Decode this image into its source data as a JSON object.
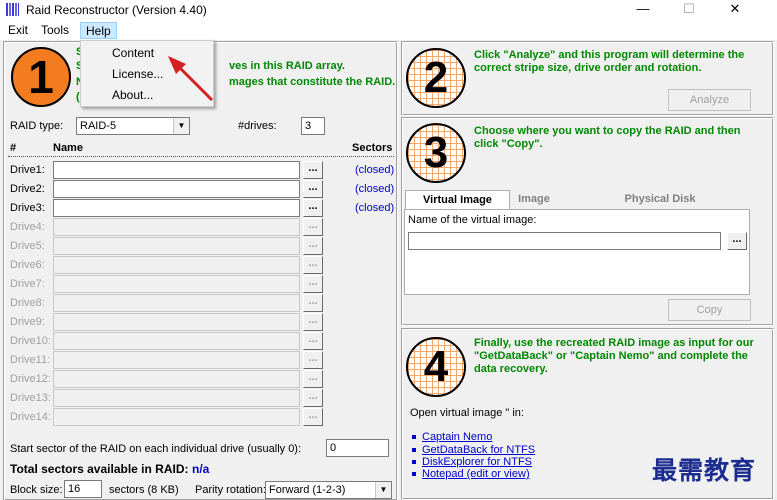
{
  "window": {
    "title": "Raid Reconstructor (Version 4.40)",
    "minimize": "—",
    "maximize": "☐",
    "close": "✕"
  },
  "menu": {
    "exit": "Exit",
    "tools": "Tools",
    "help": "Help",
    "help_items": [
      "Content",
      "License...",
      "About..."
    ]
  },
  "step1": {
    "number": "1",
    "line1": "Select the number of drives in this RAID array.",
    "line1_visible": "ves in this RAID array.",
    "line2_visible": "mages that constitute the RAID.",
    "left_fragments": [
      "S",
      "S",
      "N",
      "("
    ],
    "raid_type_label": "RAID type:",
    "raid_type_value": "RAID-5",
    "drives_label": "#drives:",
    "drives_value": "3",
    "col_hash": "#",
    "col_name": "Name",
    "col_sectors": "Sectors",
    "drives": [
      {
        "label": "Drive1:",
        "enabled": true,
        "status": "(closed)"
      },
      {
        "label": "Drive2:",
        "enabled": true,
        "status": "(closed)"
      },
      {
        "label": "Drive3:",
        "enabled": true,
        "status": "(closed)"
      },
      {
        "label": "Drive4:",
        "enabled": false,
        "status": ""
      },
      {
        "label": "Drive5:",
        "enabled": false,
        "status": ""
      },
      {
        "label": "Drive6:",
        "enabled": false,
        "status": ""
      },
      {
        "label": "Drive7:",
        "enabled": false,
        "status": ""
      },
      {
        "label": "Drive8:",
        "enabled": false,
        "status": ""
      },
      {
        "label": "Drive9:",
        "enabled": false,
        "status": ""
      },
      {
        "label": "Drive10:",
        "enabled": false,
        "status": ""
      },
      {
        "label": "Drive11:",
        "enabled": false,
        "status": ""
      },
      {
        "label": "Drive12:",
        "enabled": false,
        "status": ""
      },
      {
        "label": "Drive13:",
        "enabled": false,
        "status": ""
      },
      {
        "label": "Drive14:",
        "enabled": false,
        "status": ""
      }
    ],
    "browse_label": "...",
    "start_sector_label": "Start sector of the RAID on each individual drive (usually 0):",
    "start_sector_value": "0",
    "total_label": "Total sectors available in RAID:",
    "total_value": "n/a",
    "block_size_label": "Block size:",
    "block_size_value": "16",
    "block_size_unit": "sectors (8 KB)",
    "parity_label": "Parity rotation:",
    "parity_value": "Forward (1-2-3)"
  },
  "step2": {
    "number": "2",
    "text": "Click \"Analyze\" and this program will determine the correct stripe size, drive order and rotation.",
    "analyze": "Analyze"
  },
  "step3": {
    "number": "3",
    "text": "Choose where you want to copy the RAID and then click \"Copy\".",
    "tabs": [
      "Virtual Image",
      "Image",
      "Physical Disk"
    ],
    "name_label": "Name of the virtual image:",
    "name_value": "",
    "copy": "Copy"
  },
  "step4": {
    "number": "4",
    "text": "Finally, use the recreated RAID image as input for our \"GetDataBack\" or \"Captain Nemo\" and complete the data recovery.",
    "open_label": "Open virtual image \" in:",
    "links": [
      "Captain Nemo",
      "GetDataBack for NTFS",
      "DiskExplorer for NTFS",
      "Notepad (edit or view)"
    ]
  },
  "watermark": "最需教育",
  "colors": {
    "step_green": "#008800",
    "link_blue": "#0000cc",
    "step1_orange": "#f47c20",
    "arrow_red": "#d42020"
  }
}
